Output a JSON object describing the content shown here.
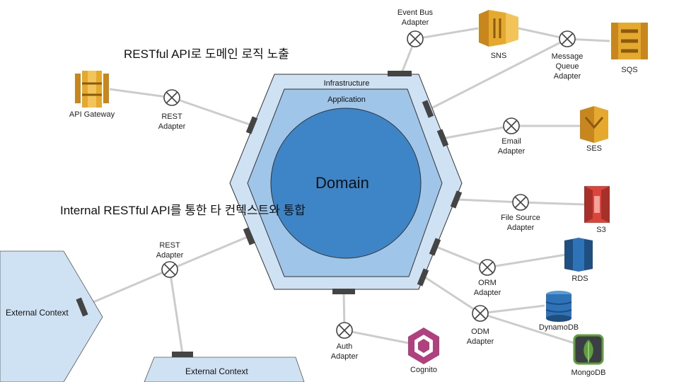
{
  "titles": {
    "rest_api": [
      "RESTful API로",
      "도메인 로직 노출"
    ],
    "internal_api": [
      "Internal RESTful API를",
      "통한 타 컨텍스트와 통합"
    ]
  },
  "layers": {
    "infrastructure": "Infrastructure",
    "application": "Application",
    "domain": "Domain"
  },
  "external_contexts": [
    "External Context",
    "External Context"
  ],
  "adapters": {
    "event_bus": [
      "Event Bus",
      "Adapter"
    ],
    "rest_top": [
      "REST",
      "Adapter"
    ],
    "message_queue": [
      "Message",
      "Queue",
      "Adapter"
    ],
    "email": [
      "Email",
      "Adapter"
    ],
    "file_source": [
      "File Source",
      "Adapter"
    ],
    "orm": [
      "ORM",
      "Adapter"
    ],
    "odm": [
      "ODM",
      "Adapter"
    ],
    "auth": [
      "Auth",
      "Adapter"
    ],
    "rest_left": [
      "REST",
      "Adapter"
    ]
  },
  "services": {
    "api_gateway": "API Gateway",
    "sns": "SNS",
    "sqs": "SQS",
    "ses": "SES",
    "s3": "S3",
    "rds": "RDS",
    "dynamodb": "DynamoDB",
    "mongodb": "MongoDB",
    "cognito": "Cognito"
  },
  "colors": {
    "infra_fill": "#cfe2f3",
    "app_fill": "#9fc5e8",
    "domain_fill": "#3d85c6",
    "outline": "#333333",
    "port": "#444444",
    "connector": "#cccccc",
    "aws_orange": "#e5a92d",
    "aws_red": "#d9443b",
    "aws_blue": "#2e73b8",
    "cognito_pink": "#b0407e",
    "mongo_green": "#5e9e3c"
  }
}
